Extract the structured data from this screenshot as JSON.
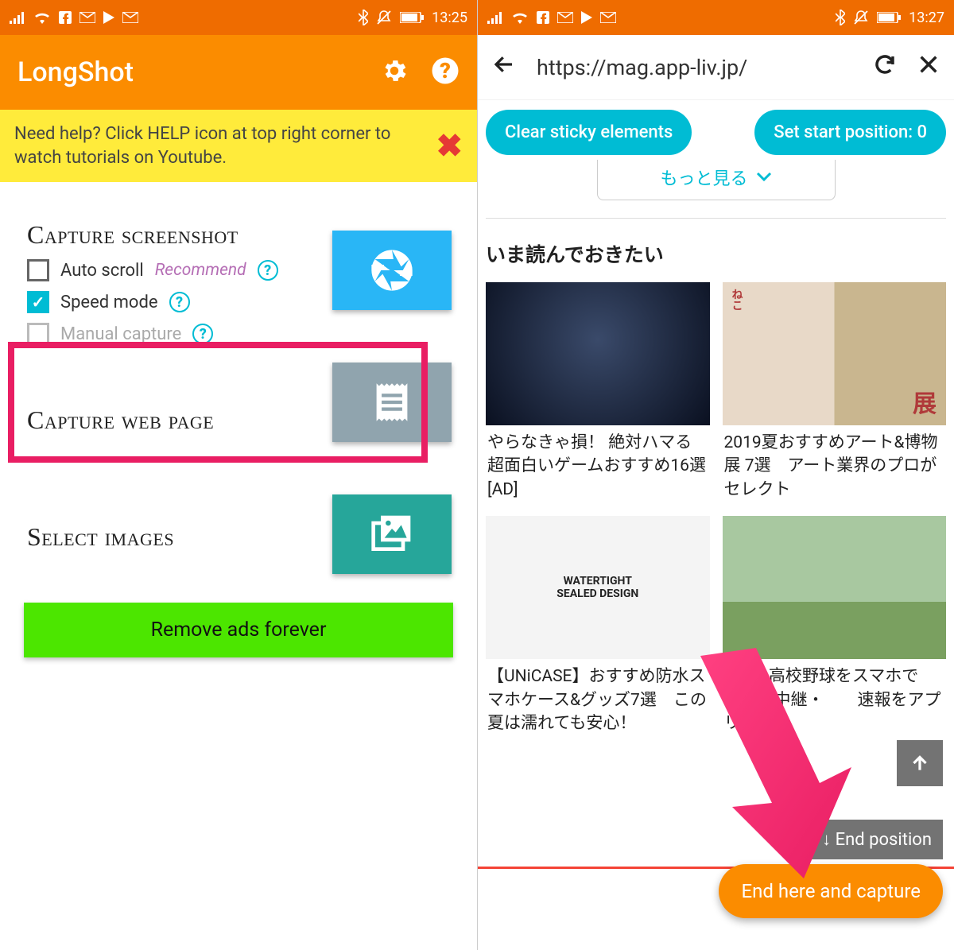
{
  "left": {
    "status": {
      "time": "13:25"
    },
    "appbar": {
      "title": "LongShot"
    },
    "help_banner": {
      "text": "Need help? Click HELP icon at top right corner to watch tutorials on Youtube."
    },
    "section1": {
      "title": "Capture screenshot",
      "opt_auto": "Auto scroll",
      "recommend": "Recommend",
      "opt_speed": "Speed mode",
      "opt_manual": "Manual capture"
    },
    "section2": {
      "title": "Capture web page"
    },
    "section3": {
      "title": "Select images"
    },
    "remove_ads": "Remove ads forever"
  },
  "right": {
    "status": {
      "time": "13:27"
    },
    "nav": {
      "url": "https://mag.app-liv.jp/"
    },
    "pills": {
      "clear": "Clear sticky elements",
      "start": "Set start position: 0"
    },
    "more": "もっと見る",
    "heading": "いま読んでおきたい",
    "cards": [
      {
        "title": "やらなきゃ損！ 絶対ハマる超面白いゲームおすすめ16選　[AD]"
      },
      {
        "title": "2019夏おすすめアート&博物展 7選　アート業界のプロがセレクト"
      },
      {
        "title": "【UNiCASE】おすすめ防水スマホケース&グッズ7選　この夏は濡れても安心！"
      },
      {
        "title": "019】高校野球をスマホで　　　　ライブ中継・　　速報をアプリで無"
      }
    ],
    "watertight": {
      "l1": "WATERTIGHT",
      "l2": "SEALED DESIGN"
    },
    "end_label": "↓ End position",
    "capture": "End here and capture"
  }
}
